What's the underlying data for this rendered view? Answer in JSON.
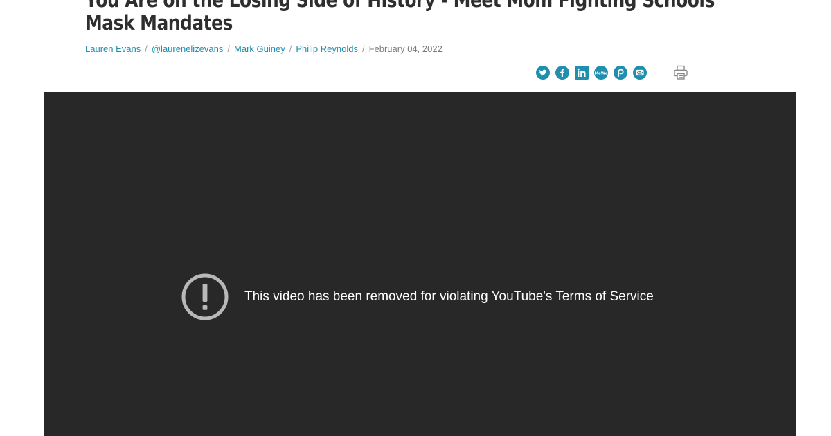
{
  "article": {
    "headline_line1": "You Are on the Losing Side of History - Meet Mom Fighting Schools'",
    "headline_line2": "Mask Mandates",
    "byline": {
      "authors": [
        "Lauren Evans",
        "@laurenelizevans",
        "Mark Guiney",
        "Philip Reynolds"
      ],
      "separator": "/",
      "date": "February 04, 2022"
    }
  },
  "share": {
    "accent_color": "#1f8fad",
    "icons": [
      "twitter-icon",
      "facebook-icon",
      "linkedin-icon",
      "mewe-icon",
      "parler-icon",
      "email-icon",
      "print-icon"
    ],
    "mewe_label": "MeWe"
  },
  "video": {
    "background_color": "#282828",
    "status_icon": "exclamation-circle-icon",
    "message": "This video has been removed for violating YouTube's Terms of Service"
  }
}
